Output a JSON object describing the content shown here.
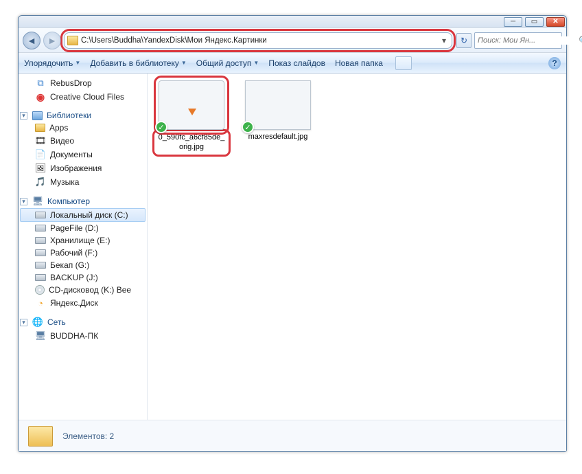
{
  "addressbar": {
    "path": "C:\\Users\\Buddha\\YandexDisk\\Мои Яндекс.Картинки"
  },
  "search": {
    "placeholder": "Поиск: Мои Ян..."
  },
  "toolbar": {
    "organize": "Упорядочить",
    "include": "Добавить в библиотеку",
    "share": "Общий доступ",
    "slideshow": "Показ слайдов",
    "newfolder": "Новая папка"
  },
  "sidebar": {
    "rebus": "RebusDrop",
    "ccf": "Creative Cloud Files",
    "libs": "Библиотеки",
    "apps": "Apps",
    "video": "Видео",
    "docs": "Документы",
    "images": "Изображения",
    "music": "Музыка",
    "computer": "Компьютер",
    "drive_c": "Локальный диск (C:)",
    "drive_d": "PageFile (D:)",
    "drive_e": "Хранилище (E:)",
    "drive_f": "Рабочий (F:)",
    "drive_g": "Бекап (G:)",
    "drive_j": "BACKUP (J:)",
    "drive_k": "CD-дисковод (K:) Bee",
    "yadisk": "Яндекс.Диск",
    "network": "Сеть",
    "net_pc": "BUDDHA-ПК"
  },
  "files": [
    {
      "name": "0_590fc_a6cf85de_orig.jpg"
    },
    {
      "name": "maxresdefault.jpg"
    }
  ],
  "status": {
    "count_label": "Элементов: 2"
  }
}
